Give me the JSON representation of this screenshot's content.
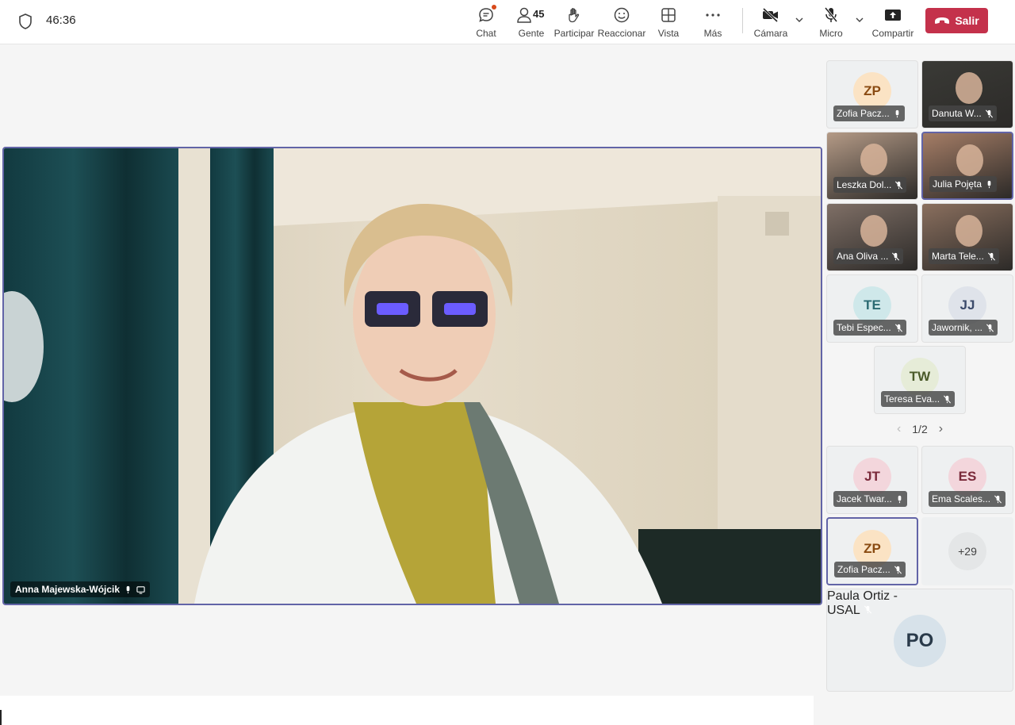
{
  "timer": "46:36",
  "toolbar": {
    "chat": "Chat",
    "people": "Gente",
    "people_count": "45",
    "raise": "Participar",
    "react": "Reaccionar",
    "view": "Vista",
    "more": "Más",
    "camera": "Cámara",
    "mic": "Micro",
    "share": "Compartir",
    "leave": "Salir"
  },
  "main": {
    "name": "Anna Majewska-Wójcik"
  },
  "participants": [
    {
      "initials": "ZP",
      "name": "Zofia Pacz...",
      "color": "#fbe3c4",
      "fg": "#8a4b12"
    },
    {
      "initials": "",
      "name": "Danuta W...",
      "video": true
    },
    {
      "initials": "",
      "name": "Leszka Dol...",
      "video": true
    },
    {
      "initials": "",
      "name": "Julia Pojęta",
      "video": true
    },
    {
      "initials": "",
      "name": "Ana Oliva ...",
      "video": true
    },
    {
      "initials": "",
      "name": "Marta Tele...",
      "video": true
    },
    {
      "initials": "TE",
      "name": "Tebi Espec...",
      "color": "#cfe8ea",
      "fg": "#2b6a72"
    },
    {
      "initials": "JJ",
      "name": "Jawornik, ...",
      "color": "#dfe3ea",
      "fg": "#3b4a6a"
    },
    {
      "initials": "TW",
      "name": "Teresa Eva...",
      "color": "#e6ecd8",
      "fg": "#4a5a2a"
    }
  ],
  "pager": "1/2",
  "pinned": [
    {
      "initials": "JT",
      "name": "Jacek Twar...",
      "color": "#f3d6dc",
      "fg": "#7a2a3a"
    },
    {
      "initials": "ES",
      "name": "Ema Scales...",
      "color": "#f3d6dc",
      "fg": "#7a2a3a"
    },
    {
      "initials": "ZP",
      "name": "Zofia Pacz...",
      "color": "#fbe3c4",
      "fg": "#8a4b12"
    }
  ],
  "overflow": "+29",
  "big": {
    "initials": "PO",
    "name": "Paula Ortiz - USAL",
    "color": "#d7e2ea",
    "fg": "#2a3a4a"
  }
}
